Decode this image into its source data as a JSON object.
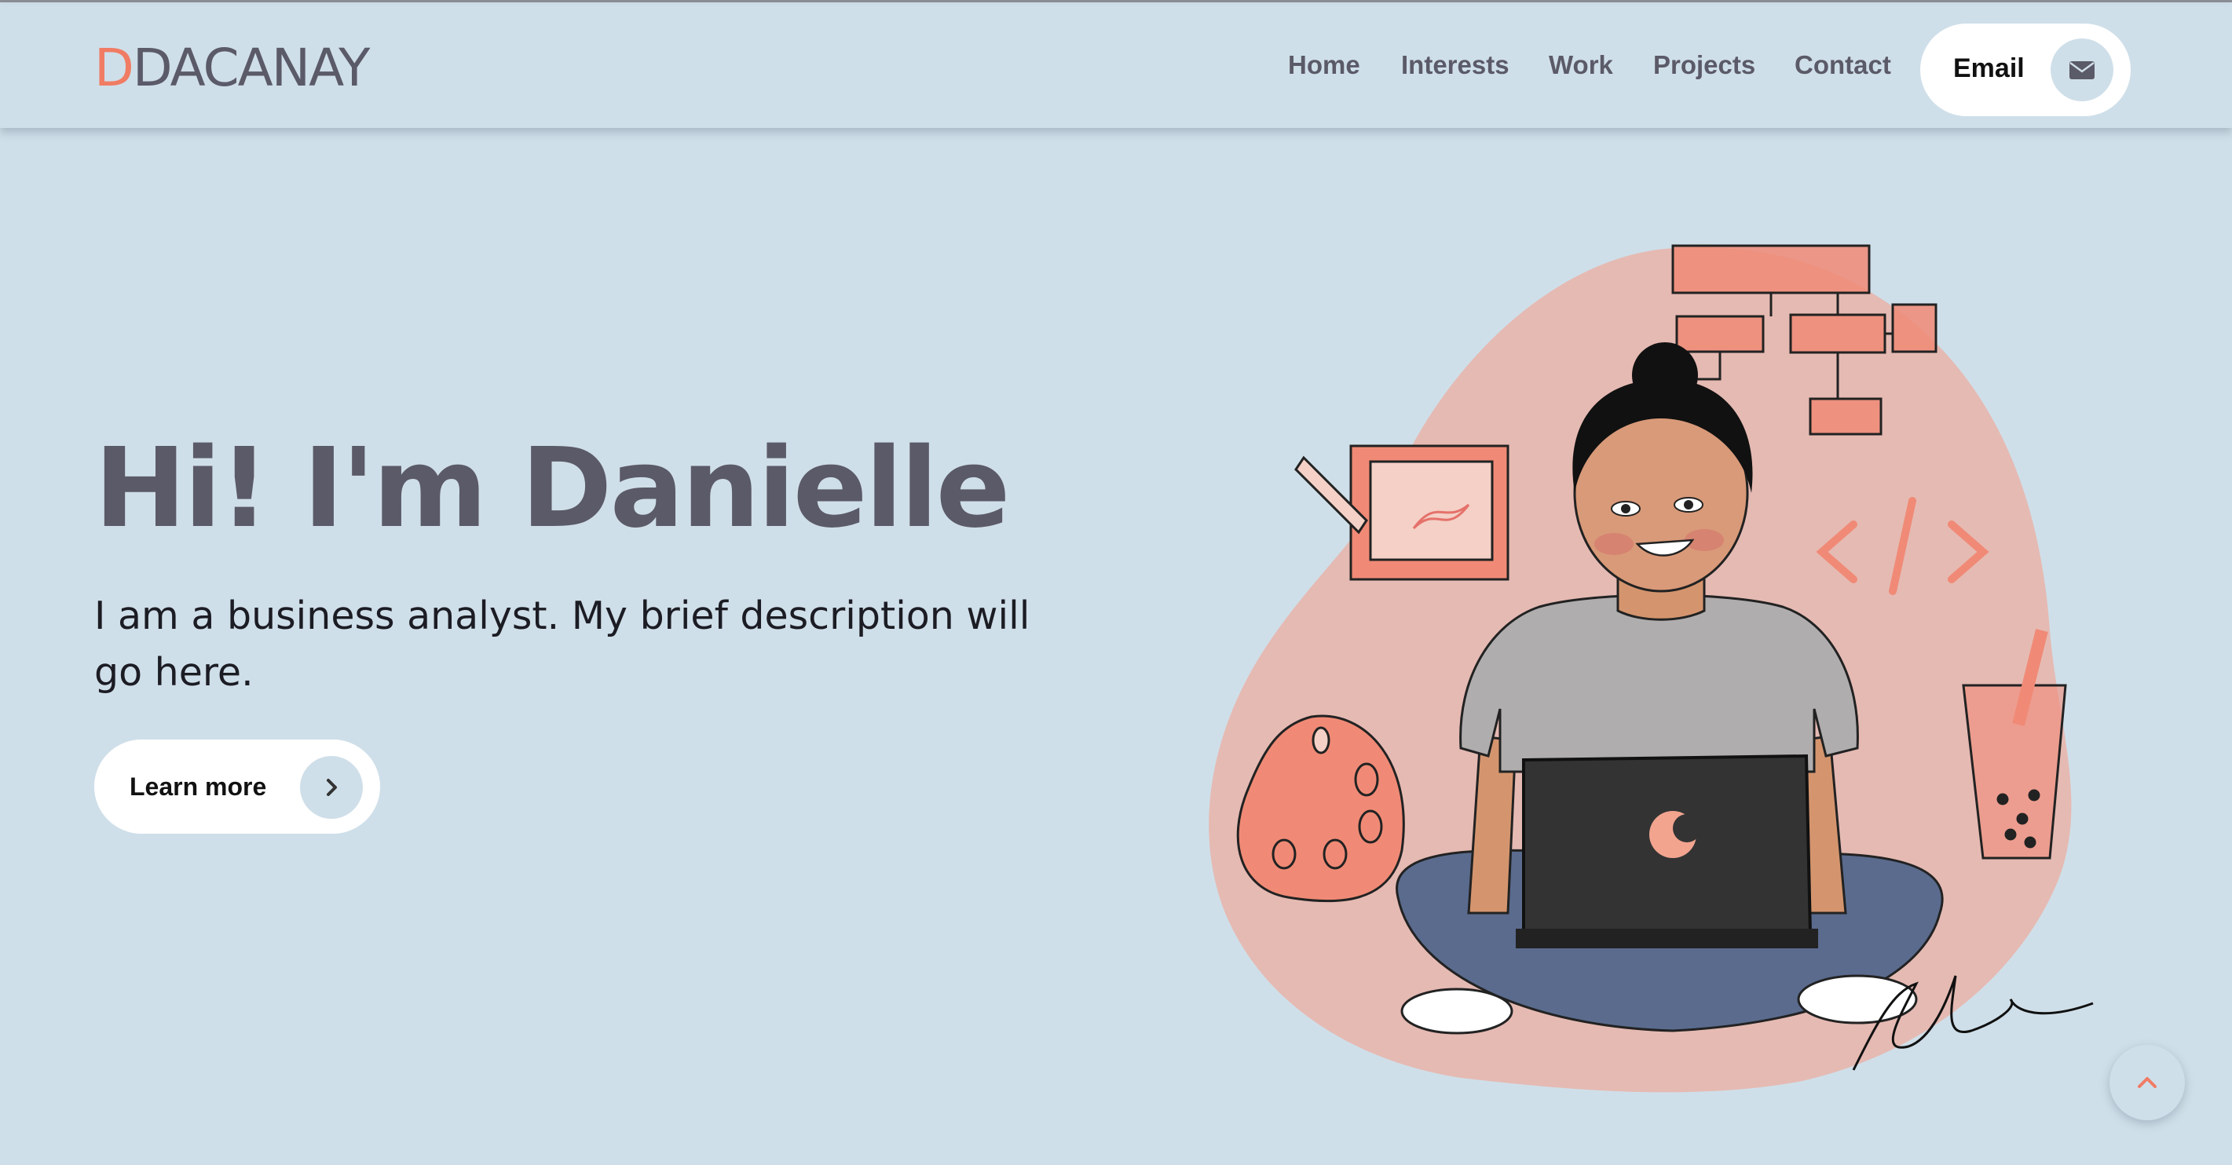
{
  "brand": {
    "initial": "D",
    "rest": "DACANAY",
    "accent_color": "#f07c64",
    "text_color": "#5b5a68"
  },
  "nav": {
    "links": [
      {
        "label": "Home"
      },
      {
        "label": "Interests"
      },
      {
        "label": "Work"
      },
      {
        "label": "Projects"
      },
      {
        "label": "Contact"
      }
    ],
    "email_button": {
      "label": "Email",
      "icon": "envelope-icon"
    }
  },
  "hero": {
    "title": "Hi! I'm Danielle",
    "description": "I am a business analyst. My brief description will go here.",
    "cta": {
      "label": "Learn more",
      "icon": "chevron-right-icon"
    },
    "illustration": {
      "signature_text": "Danielle"
    }
  },
  "scroll_top": {
    "icon": "chevron-up-icon"
  },
  "colors": {
    "background": "#cfdfe9",
    "blob": "#e5bab3",
    "coral": "#f08a76",
    "white": "#ffffff"
  }
}
